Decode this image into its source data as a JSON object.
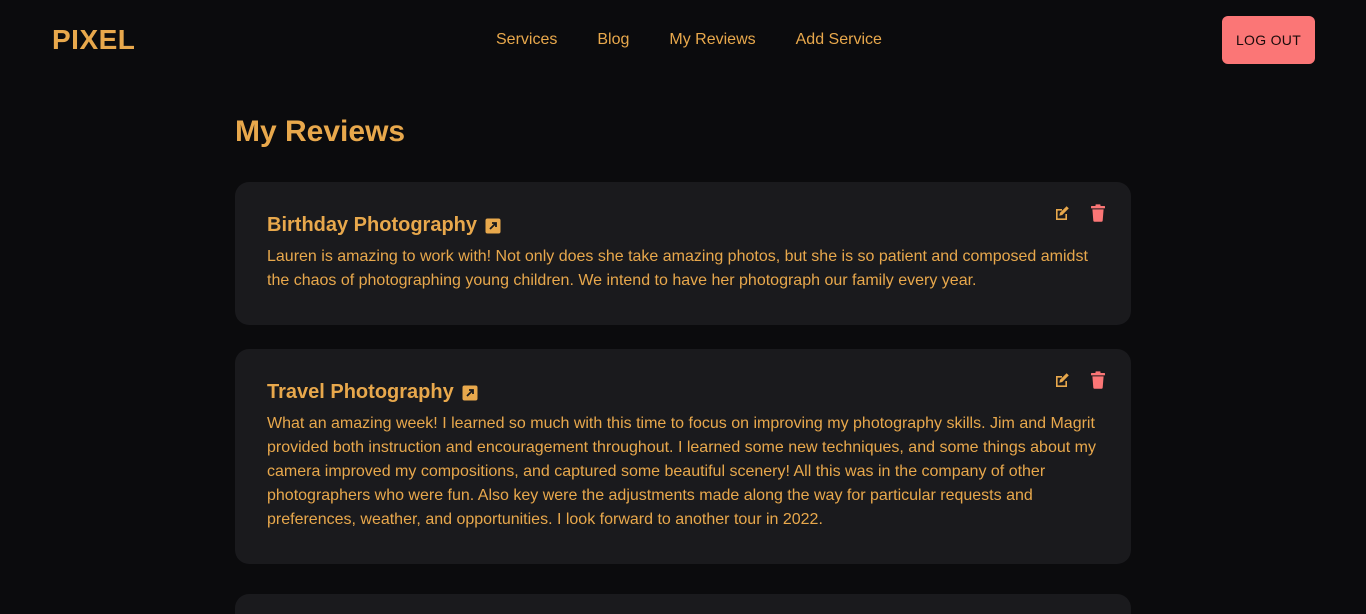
{
  "brand": {
    "name": "PIXEL"
  },
  "nav": {
    "links": [
      {
        "label": "Services"
      },
      {
        "label": "Blog"
      },
      {
        "label": "My Reviews"
      },
      {
        "label": "Add Service"
      }
    ],
    "logout_label": "LOG OUT"
  },
  "page": {
    "title": "My Reviews"
  },
  "reviews": [
    {
      "service": "Birthday Photography",
      "text": "Lauren is amazing to work with! Not only does she take amazing photos, but she is so patient and composed amidst the chaos of photographing young children. We intend to have her photograph our family every year."
    },
    {
      "service": "Travel Photography",
      "text": "What an amazing week! I learned so much with this time to focus on improving my photography skills. Jim and Magrit provided both instruction and encouragement throughout. I learned some new techniques, and some things about my camera improved my compositions, and captured some beautiful scenery! All this was in the company of other photographers who were fun. Also key were the adjustments made along the way for particular requests and preferences, weather, and opportunities. I look forward to another tour in 2022."
    }
  ],
  "icons": {
    "edit": "edit-icon",
    "delete": "trash-icon",
    "external": "external-link-icon"
  },
  "colors": {
    "background": "#0b0b0d",
    "card": "#1a1a1d",
    "accent": "#e8a84c",
    "danger": "#fb7676"
  }
}
